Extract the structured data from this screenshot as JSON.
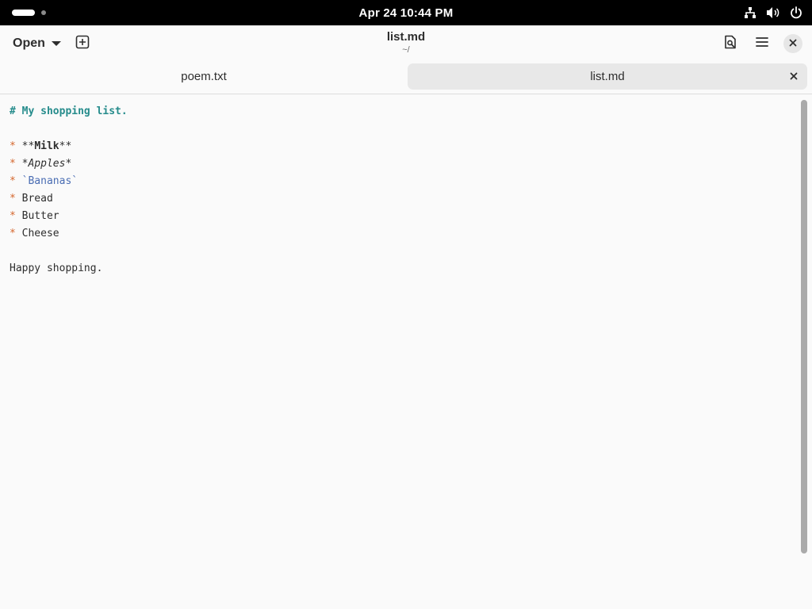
{
  "topbar": {
    "clock": "Apr 24  10:44 PM",
    "tray_icons": [
      "network-icon",
      "volume-icon",
      "power-icon"
    ]
  },
  "headerbar": {
    "open_label": "Open",
    "title": "list.md",
    "subtitle": "~/",
    "buttons": [
      "new-tab-icon",
      "search-document-icon",
      "hamburger-menu-icon",
      "close-icon"
    ]
  },
  "tabs": [
    {
      "label": "poem.txt",
      "active": false
    },
    {
      "label": "list.md",
      "active": true
    }
  ],
  "editor": {
    "heading": "# My shopping list.",
    "bullet_marker": "*",
    "items": [
      {
        "prefix": "**",
        "text": "Milk",
        "suffix": "**"
      },
      {
        "prefix": "*",
        "text": "Apples",
        "suffix": "*"
      },
      {
        "prefix": "`",
        "text": "Bananas",
        "suffix": "`"
      },
      {
        "text": "Bread"
      },
      {
        "text": "Butter"
      },
      {
        "text": "Cheese"
      }
    ],
    "footer": "Happy shopping."
  },
  "colors": {
    "heading": "#268c8c",
    "bullet": "#d4662c",
    "code": "#4a6db3",
    "text": "#2e2e2e"
  }
}
